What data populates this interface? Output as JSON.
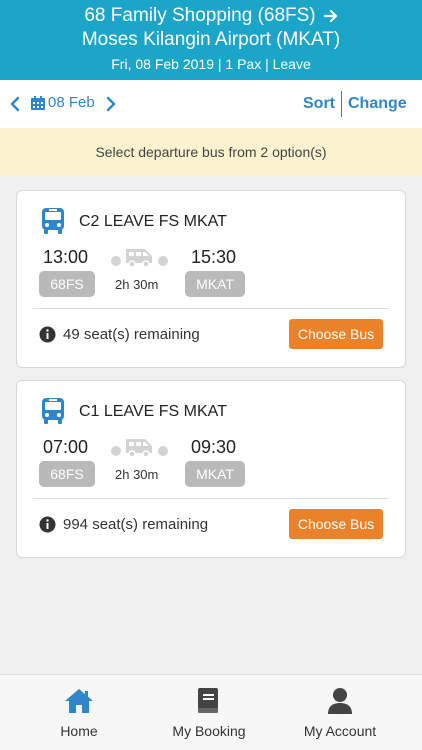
{
  "header": {
    "origin": "68 Family Shopping (68FS)",
    "destination": "Moses Kilangin Airport (MKAT)",
    "details": "Fri, 08 Feb 2019 | 1 Pax | Leave"
  },
  "datebar": {
    "date": "08 Feb",
    "sort_label": "Sort",
    "change_label": "Change"
  },
  "notice": "Select departure bus from 2 option(s)",
  "buses": [
    {
      "route": "C2 LEAVE FS MKAT",
      "depart_time": "13:00",
      "depart_code": "68FS",
      "arrive_time": "15:30",
      "arrive_code": "MKAT",
      "duration": "2h 30m",
      "seats": "49 seat(s) remaining",
      "button": "Choose Bus"
    },
    {
      "route": "C1 LEAVE FS MKAT",
      "depart_time": "07:00",
      "depart_code": "68FS",
      "arrive_time": "09:30",
      "arrive_code": "MKAT",
      "duration": "2h 30m",
      "seats": "994 seat(s) remaining",
      "button": "Choose Bus"
    }
  ],
  "tabbar": {
    "items": [
      {
        "label": "Home",
        "icon": "home-icon"
      },
      {
        "label": "My Booking",
        "icon": "book-icon"
      },
      {
        "label": "My Account",
        "icon": "user-icon"
      }
    ]
  },
  "colors": {
    "header_bg": "#1ba6c9",
    "accent_blue": "#2f86c9",
    "button_orange": "#e9822a",
    "notice_bg": "#fbf3cf",
    "tab_active": "#2f86c9"
  }
}
